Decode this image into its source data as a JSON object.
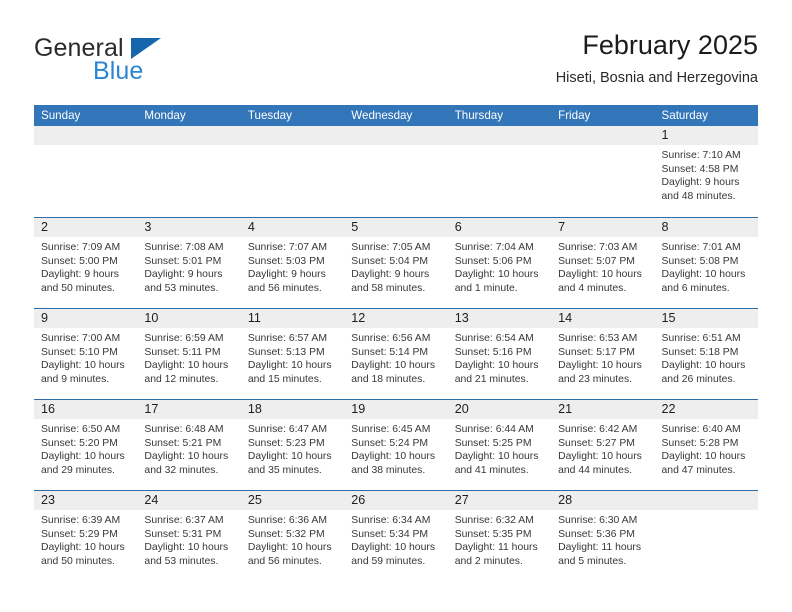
{
  "brand": {
    "name_top": "General",
    "name_bottom": "Blue",
    "color_dark": "#2b2b2b",
    "color_blue": "#2b85d0",
    "triangle_color": "#1566ad"
  },
  "header": {
    "month_title": "February 2025",
    "location": "Hiseti, Bosnia and Herzegovina",
    "header_bg": "#3275b8",
    "header_text": "#ffffff",
    "row_divider": "#2d6da8",
    "daynum_band": "#eeeeee"
  },
  "weekdays": [
    "Sunday",
    "Monday",
    "Tuesday",
    "Wednesday",
    "Thursday",
    "Friday",
    "Saturday"
  ],
  "weeks": [
    [
      {
        "empty": true
      },
      {
        "empty": true
      },
      {
        "empty": true
      },
      {
        "empty": true
      },
      {
        "empty": true
      },
      {
        "empty": true
      },
      {
        "day": "1",
        "sunrise": "Sunrise: 7:10 AM",
        "sunset": "Sunset: 4:58 PM",
        "daylight1": "Daylight: 9 hours",
        "daylight2": "and 48 minutes."
      }
    ],
    [
      {
        "day": "2",
        "sunrise": "Sunrise: 7:09 AM",
        "sunset": "Sunset: 5:00 PM",
        "daylight1": "Daylight: 9 hours",
        "daylight2": "and 50 minutes."
      },
      {
        "day": "3",
        "sunrise": "Sunrise: 7:08 AM",
        "sunset": "Sunset: 5:01 PM",
        "daylight1": "Daylight: 9 hours",
        "daylight2": "and 53 minutes."
      },
      {
        "day": "4",
        "sunrise": "Sunrise: 7:07 AM",
        "sunset": "Sunset: 5:03 PM",
        "daylight1": "Daylight: 9 hours",
        "daylight2": "and 56 minutes."
      },
      {
        "day": "5",
        "sunrise": "Sunrise: 7:05 AM",
        "sunset": "Sunset: 5:04 PM",
        "daylight1": "Daylight: 9 hours",
        "daylight2": "and 58 minutes."
      },
      {
        "day": "6",
        "sunrise": "Sunrise: 7:04 AM",
        "sunset": "Sunset: 5:06 PM",
        "daylight1": "Daylight: 10 hours",
        "daylight2": "and 1 minute."
      },
      {
        "day": "7",
        "sunrise": "Sunrise: 7:03 AM",
        "sunset": "Sunset: 5:07 PM",
        "daylight1": "Daylight: 10 hours",
        "daylight2": "and 4 minutes."
      },
      {
        "day": "8",
        "sunrise": "Sunrise: 7:01 AM",
        "sunset": "Sunset: 5:08 PM",
        "daylight1": "Daylight: 10 hours",
        "daylight2": "and 6 minutes."
      }
    ],
    [
      {
        "day": "9",
        "sunrise": "Sunrise: 7:00 AM",
        "sunset": "Sunset: 5:10 PM",
        "daylight1": "Daylight: 10 hours",
        "daylight2": "and 9 minutes."
      },
      {
        "day": "10",
        "sunrise": "Sunrise: 6:59 AM",
        "sunset": "Sunset: 5:11 PM",
        "daylight1": "Daylight: 10 hours",
        "daylight2": "and 12 minutes."
      },
      {
        "day": "11",
        "sunrise": "Sunrise: 6:57 AM",
        "sunset": "Sunset: 5:13 PM",
        "daylight1": "Daylight: 10 hours",
        "daylight2": "and 15 minutes."
      },
      {
        "day": "12",
        "sunrise": "Sunrise: 6:56 AM",
        "sunset": "Sunset: 5:14 PM",
        "daylight1": "Daylight: 10 hours",
        "daylight2": "and 18 minutes."
      },
      {
        "day": "13",
        "sunrise": "Sunrise: 6:54 AM",
        "sunset": "Sunset: 5:16 PM",
        "daylight1": "Daylight: 10 hours",
        "daylight2": "and 21 minutes."
      },
      {
        "day": "14",
        "sunrise": "Sunrise: 6:53 AM",
        "sunset": "Sunset: 5:17 PM",
        "daylight1": "Daylight: 10 hours",
        "daylight2": "and 23 minutes."
      },
      {
        "day": "15",
        "sunrise": "Sunrise: 6:51 AM",
        "sunset": "Sunset: 5:18 PM",
        "daylight1": "Daylight: 10 hours",
        "daylight2": "and 26 minutes."
      }
    ],
    [
      {
        "day": "16",
        "sunrise": "Sunrise: 6:50 AM",
        "sunset": "Sunset: 5:20 PM",
        "daylight1": "Daylight: 10 hours",
        "daylight2": "and 29 minutes."
      },
      {
        "day": "17",
        "sunrise": "Sunrise: 6:48 AM",
        "sunset": "Sunset: 5:21 PM",
        "daylight1": "Daylight: 10 hours",
        "daylight2": "and 32 minutes."
      },
      {
        "day": "18",
        "sunrise": "Sunrise: 6:47 AM",
        "sunset": "Sunset: 5:23 PM",
        "daylight1": "Daylight: 10 hours",
        "daylight2": "and 35 minutes."
      },
      {
        "day": "19",
        "sunrise": "Sunrise: 6:45 AM",
        "sunset": "Sunset: 5:24 PM",
        "daylight1": "Daylight: 10 hours",
        "daylight2": "and 38 minutes."
      },
      {
        "day": "20",
        "sunrise": "Sunrise: 6:44 AM",
        "sunset": "Sunset: 5:25 PM",
        "daylight1": "Daylight: 10 hours",
        "daylight2": "and 41 minutes."
      },
      {
        "day": "21",
        "sunrise": "Sunrise: 6:42 AM",
        "sunset": "Sunset: 5:27 PM",
        "daylight1": "Daylight: 10 hours",
        "daylight2": "and 44 minutes."
      },
      {
        "day": "22",
        "sunrise": "Sunrise: 6:40 AM",
        "sunset": "Sunset: 5:28 PM",
        "daylight1": "Daylight: 10 hours",
        "daylight2": "and 47 minutes."
      }
    ],
    [
      {
        "day": "23",
        "sunrise": "Sunrise: 6:39 AM",
        "sunset": "Sunset: 5:29 PM",
        "daylight1": "Daylight: 10 hours",
        "daylight2": "and 50 minutes."
      },
      {
        "day": "24",
        "sunrise": "Sunrise: 6:37 AM",
        "sunset": "Sunset: 5:31 PM",
        "daylight1": "Daylight: 10 hours",
        "daylight2": "and 53 minutes."
      },
      {
        "day": "25",
        "sunrise": "Sunrise: 6:36 AM",
        "sunset": "Sunset: 5:32 PM",
        "daylight1": "Daylight: 10 hours",
        "daylight2": "and 56 minutes."
      },
      {
        "day": "26",
        "sunrise": "Sunrise: 6:34 AM",
        "sunset": "Sunset: 5:34 PM",
        "daylight1": "Daylight: 10 hours",
        "daylight2": "and 59 minutes."
      },
      {
        "day": "27",
        "sunrise": "Sunrise: 6:32 AM",
        "sunset": "Sunset: 5:35 PM",
        "daylight1": "Daylight: 11 hours",
        "daylight2": "and 2 minutes."
      },
      {
        "day": "28",
        "sunrise": "Sunrise: 6:30 AM",
        "sunset": "Sunset: 5:36 PM",
        "daylight1": "Daylight: 11 hours",
        "daylight2": "and 5 minutes."
      },
      {
        "empty": true
      }
    ]
  ]
}
